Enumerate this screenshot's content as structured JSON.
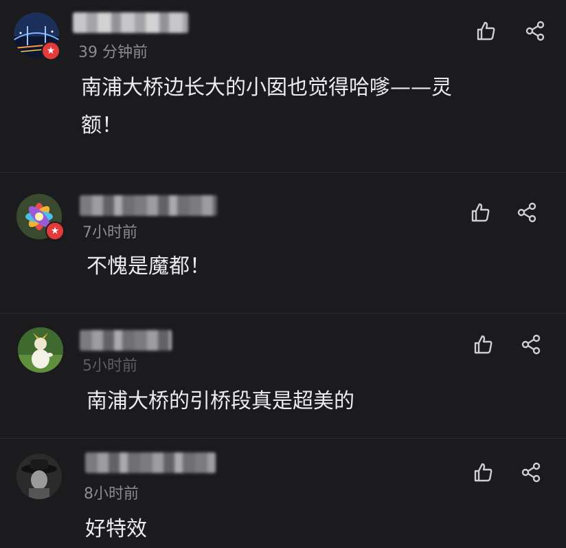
{
  "comments": [
    {
      "username_blurred": "",
      "time": "39 分钟前",
      "text": "南浦大桥边长大的小囡也觉得哈嗲——灵额！",
      "text_lines": [
        "南浦大桥边长大的小囡也觉得哈嗲——灵",
        "额！"
      ],
      "avatar": "city-bridge-night-avatar",
      "verified_badge": "★"
    },
    {
      "username_blurred": "",
      "time": "7小时前",
      "text": "不愧是魔都！",
      "avatar": "colorful-flower-avatar",
      "verified_badge": "★"
    },
    {
      "username_blurred": "",
      "time": "5小时前",
      "text": "南浦大桥的引桥段真是超美的",
      "avatar": "cartoon-figure-avatar"
    },
    {
      "username_blurred": "",
      "time": "8小时前",
      "text": "好特效",
      "avatar": "hat-person-avatar"
    }
  ],
  "icons": {
    "like": "thumbs-up-icon",
    "share": "share-icon"
  },
  "colors": {
    "background": "#1b1b1e",
    "text": "#ececee",
    "meta": "#8b8b90",
    "badge": "#e23b3b"
  }
}
